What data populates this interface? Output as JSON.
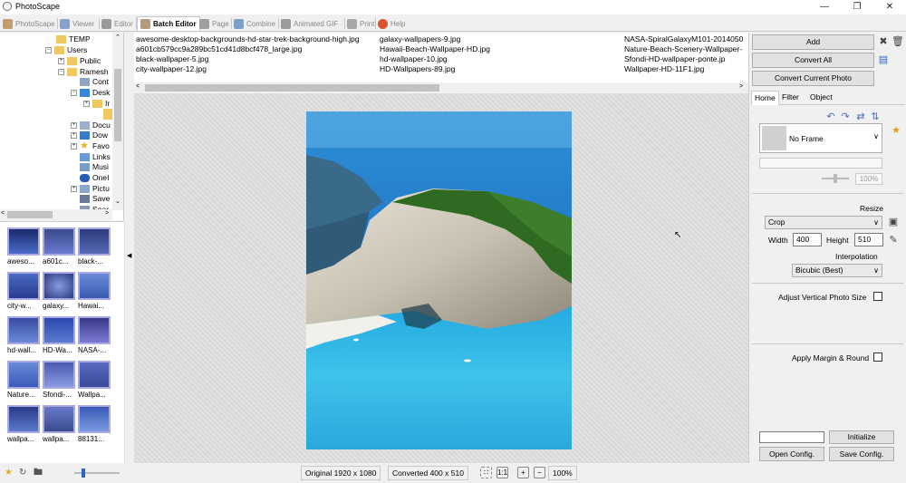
{
  "window": {
    "title": "PhotoScape",
    "controls": [
      "minimize-icon",
      "maximize-icon",
      "close-icon"
    ]
  },
  "tabs": [
    {
      "label": "PhotoScape",
      "icon": "photoscape-icon"
    },
    {
      "label": "Viewer",
      "icon": "viewer-icon"
    },
    {
      "label": "Editor",
      "icon": "editor-icon"
    },
    {
      "label": "Batch Editor",
      "icon": "batch-editor-icon",
      "active": true
    },
    {
      "label": "Page",
      "icon": "page-icon"
    },
    {
      "label": "Combine",
      "icon": "combine-icon"
    },
    {
      "label": "Animated GIF",
      "icon": "animated-gif-icon"
    },
    {
      "label": "Print",
      "icon": "print-icon"
    },
    {
      "label": "Help",
      "icon": "help-icon"
    }
  ],
  "tree": [
    {
      "label": "TEMP"
    },
    {
      "label": "Users"
    },
    {
      "label": "Public"
    },
    {
      "label": "Ramesh"
    },
    {
      "label": "Cont"
    },
    {
      "label": "Desk"
    },
    {
      "label": "Ir"
    },
    {
      "label": "Docu"
    },
    {
      "label": "Dow"
    },
    {
      "label": "Favo"
    },
    {
      "label": "Links"
    },
    {
      "label": "Musi"
    },
    {
      "label": "OneI"
    },
    {
      "label": "Pictu"
    },
    {
      "label": "Save"
    },
    {
      "label": "Sear"
    }
  ],
  "thumbnails": [
    {
      "label": "aweso..."
    },
    {
      "label": "a601c..."
    },
    {
      "label": "black-..."
    },
    {
      "label": "city-w..."
    },
    {
      "label": "galaxy..."
    },
    {
      "label": "Hawai..."
    },
    {
      "label": "hd-wall..."
    },
    {
      "label": "HD-Wa..."
    },
    {
      "label": "NASA-..."
    },
    {
      "label": "Nature..."
    },
    {
      "label": "Sfondi-..."
    },
    {
      "label": "Wallpa..."
    },
    {
      "label": "wallpa..."
    },
    {
      "label": "wallpa..."
    },
    {
      "label": "88131..."
    }
  ],
  "file_list": {
    "col1": [
      "awesome-desktop-backgrounds-hd-star-trek-background-high.jpg",
      "a601cb579cc9a289bc51cd41d8bcf478_large.jpg",
      "black-wallpaper-5.jpg",
      "city-wallpaper-12.jpg"
    ],
    "col2": [
      "galaxy-wallpapers-9.jpg",
      "Hawaii-Beach-Wallpaper-HD.jpg",
      "hd-wallpaper-10.jpg",
      "HD-Wallpapers-89.jpg"
    ],
    "col3": [
      "NASA-SpiralGalaxyM101-2014050",
      "Nature-Beach-Scenery-Wallpaper-",
      "Sfondi-HD-wallpaper-ponte.jp",
      "Wallpaper-HD-11F1.jpg"
    ]
  },
  "right_panel": {
    "add_label": "Add",
    "convert_all_label": "Convert All",
    "convert_current_label": "Convert Current Photo",
    "tabs": [
      "Home",
      "Filter",
      "Object"
    ],
    "frame_value": "No Frame",
    "frame_percent": "100%",
    "resize_label": "Resize",
    "resize_mode": "Crop",
    "width_label": "Width",
    "width_value": "400",
    "height_label": "Height",
    "height_value": "510",
    "interpolation_label": "Interpolation",
    "interpolation_value": "Bicubic (Best)",
    "adjust_vertical_label": "Adjust Vertical Photo Size",
    "apply_margin_label": "Apply Margin & Round",
    "initialize_label": "Initialize",
    "open_config_label": "Open Config.",
    "save_config_label": "Save Config."
  },
  "status": {
    "original": "Original 1920 x 1080",
    "converted": "Converted 400 x 510",
    "zoom": "100%"
  }
}
